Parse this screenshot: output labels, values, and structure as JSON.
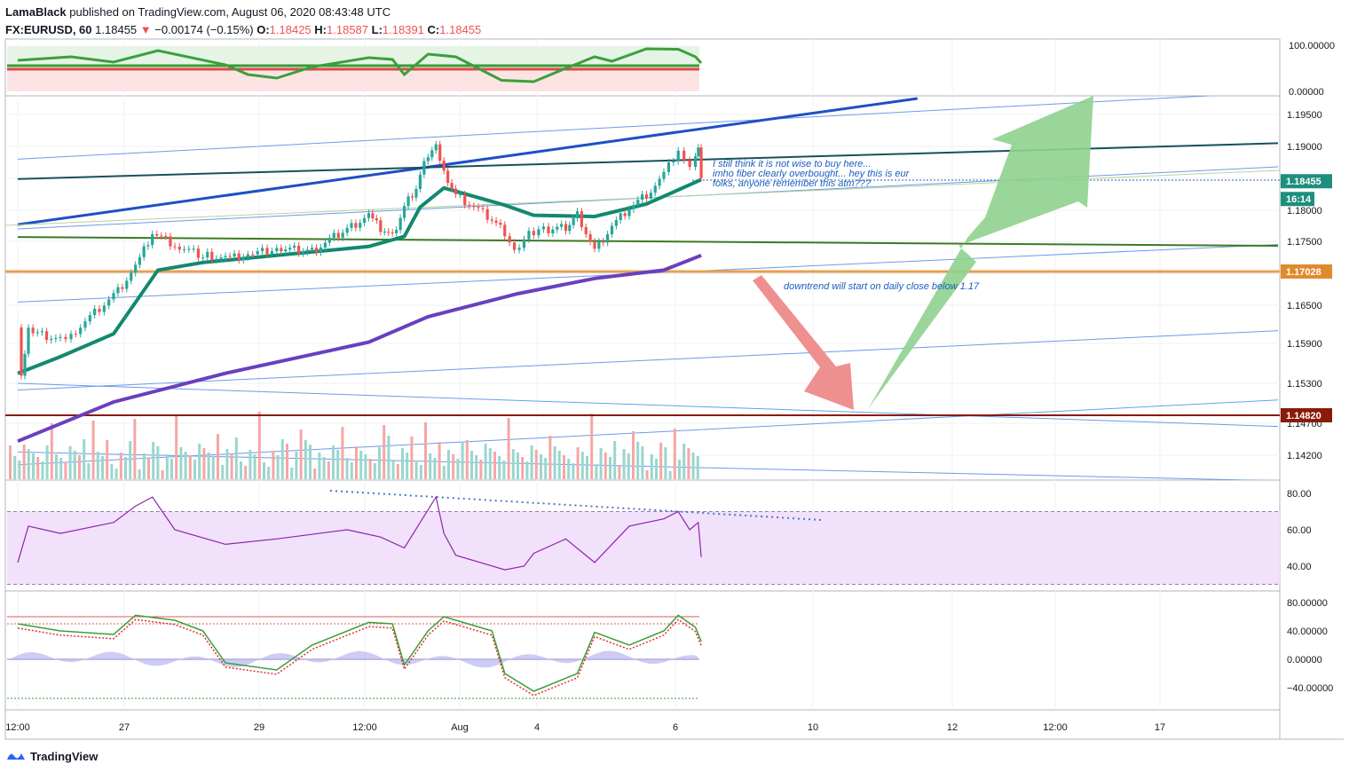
{
  "header": {
    "publisher": "LamaBlack",
    "published_text": "published on TradingView.com, August 06, 2020 08:43:48 UTC",
    "symbol": "FX:EURUSD, 60",
    "last": "1.18455",
    "change": "−0.00174 (−0.15%)",
    "o_label": "O:",
    "o": "1.18425",
    "h_label": "H:",
    "h": "1.18587",
    "l_label": "L:",
    "l": "1.18391",
    "c_label": "C:",
    "c": "1.18455"
  },
  "footer": {
    "brand": "TradingView"
  },
  "colors": {
    "price_axis_bg": "#ffffff",
    "blue_trend": "#1e4fc7",
    "dark_teal_line": "#17515a",
    "green_line": "#3a7a24",
    "orange_level": "#e8a050",
    "darkred_level": "#8a1a0a",
    "teal_ma": "#12896f",
    "purple_ma": "#6a3fbf",
    "up_candle": "#26a69a",
    "down_candle": "#ef5350",
    "rsi_line": "#8e24aa",
    "rsi_band": "#f1e1fb",
    "green_arrow": "#8fd18f",
    "red_arrow": "#ee8a8a"
  },
  "price_axis": {
    "labels": [
      "1.19500",
      "1.19000",
      "1.18000",
      "1.17500",
      "1.16500",
      "1.15900",
      "1.15300",
      "1.14700",
      "1.14200"
    ],
    "current_price": "1.18455",
    "countdown": "16:14",
    "level_orange": "1.17028",
    "level_darkred": "1.14820"
  },
  "top_osc_axis": {
    "labels": [
      "100.00000",
      "0.00000"
    ]
  },
  "rsi_axis": {
    "labels": [
      "80.00",
      "60.00",
      "40.00"
    ]
  },
  "stoch_axis": {
    "labels": [
      "80.00000",
      "40.00000",
      "0.00000",
      "−40.00000"
    ]
  },
  "time_axis": {
    "labels": [
      "12:00",
      "27",
      "29",
      "12:00",
      "Aug",
      "4",
      "6",
      "10",
      "12",
      "12:00",
      "17"
    ]
  },
  "annotations": {
    "note_lines": [
      "I still think it is not wise to buy here...",
      "imho fiber clearly overbought... hey this is eur",
      "folks, anyone remember this atm???"
    ],
    "downtrend_note": "downtrend will start on daily close below 1.17"
  },
  "chart_data": {
    "type": "candlestick",
    "symbol": "FX:EURUSD",
    "timeframe": "60",
    "x_range": [
      "Jul 24 12:00",
      "Aug 18"
    ],
    "ylim": [
      1.139,
      1.2
    ],
    "key_path": [
      [
        "Jul 24 12:00",
        1.1615
      ],
      [
        "Jul 24 14:00",
        1.1535
      ],
      [
        "Jul 24 18:00",
        1.1608
      ],
      [
        "Jul 25 12:00",
        1.1595
      ],
      [
        "Jul 25 18:00",
        1.1605
      ],
      [
        "Jul 26 18:00",
        1.1664
      ],
      [
        "Jul 27 04:00",
        1.171
      ],
      [
        "Jul 27 10:00",
        1.1765
      ],
      [
        "Jul 27 18:00",
        1.1745
      ],
      [
        "Jul 28 04:00",
        1.1728
      ],
      [
        "Jul 28 12:00",
        1.1722
      ],
      [
        "Jul 28 20:00",
        1.1728
      ],
      [
        "Jul 29 04:00",
        1.1738
      ],
      [
        "Jul 29 12:00",
        1.1735
      ],
      [
        "Jul 29 20:00",
        1.177
      ],
      [
        "Jul 30 02:00",
        1.1792
      ],
      [
        "Jul 30 08:00",
        1.1772
      ],
      [
        "Jul 30 14:00",
        1.1758
      ],
      [
        "Jul 30 20:00",
        1.1805
      ],
      [
        "Jul 31 02:00",
        1.1835
      ],
      [
        "Jul 31 08:00",
        1.1888
      ],
      [
        "Jul 31 12:00",
        1.19
      ],
      [
        "Jul 31 16:00",
        1.1862
      ],
      [
        "Jul 31 22:00",
        1.1825
      ],
      [
        "Aug 2 20:00",
        1.1785
      ],
      [
        "Aug 3 04:00",
        1.1765
      ],
      [
        "Aug 3 10:00",
        1.1735
      ],
      [
        "Aug 3 16:00",
        1.1755
      ],
      [
        "Aug 3 22:00",
        1.1765
      ],
      [
        "Aug 4 04:00",
        1.1768
      ],
      [
        "Aug 4 10:00",
        1.1772
      ],
      [
        "Aug 4 14:00",
        1.1795
      ],
      [
        "Aug 4 20:00",
        1.1735
      ],
      [
        "Aug 5 02:00",
        1.1775
      ],
      [
        "Aug 5 08:00",
        1.1805
      ],
      [
        "Aug 5 14:00",
        1.1825
      ],
      [
        "Aug 5 20:00",
        1.1855
      ],
      [
        "Aug 6 02:00",
        1.1895
      ],
      [
        "Aug 6 06:00",
        1.1875
      ],
      [
        "Aug 6 10:00",
        1.1868
      ],
      [
        "Aug 6 14:00",
        1.1888
      ],
      [
        "Aug 6 16:00",
        1.1905
      ],
      [
        "Aug 6 18:00",
        1.18455
      ]
    ],
    "indicators": {
      "teal_ma_path": [
        [
          "Jul 24 12:00",
          1.1545
        ],
        [
          "Jul 25 12:00",
          1.157
        ],
        [
          "Jul 26 18:00",
          1.1605
        ],
        [
          "Jul 27 12:00",
          1.1705
        ],
        [
          "Jul 28 04:00",
          1.1717
        ],
        [
          "Jul 29 04:00",
          1.1728
        ],
        [
          "Jul 30 02:00",
          1.1742
        ],
        [
          "Jul 30 20:00",
          1.1758
        ],
        [
          "Jul 31 04:00",
          1.1805
        ],
        [
          "Jul 31 16:00",
          1.1835
        ],
        [
          "Aug 3 04:00",
          1.1808
        ],
        [
          "Aug 3 22:00",
          1.1792
        ],
        [
          "Aug 4 20:00",
          1.179
        ],
        [
          "Aug 5 14:00",
          1.181
        ],
        [
          "Aug 6 02:00",
          1.1832
        ],
        [
          "Aug 6 18:00",
          1.1848
        ]
      ],
      "purple_ma_path": [
        [
          "Jul 24 12:00",
          1.1442
        ],
        [
          "Jul 26 18:00",
          1.1502
        ],
        [
          "Jul 28 12:00",
          1.1545
        ],
        [
          "Jul 30 02:00",
          1.1592
        ],
        [
          "Jul 31 08:00",
          1.1632
        ],
        [
          "Aug 3 12:00",
          1.1668
        ],
        [
          "Aug 4 20:00",
          1.1692
        ],
        [
          "Aug 5 20:00",
          1.1705
        ],
        [
          "Aug 6 18:00",
          1.1728
        ]
      ]
    },
    "horizontal_levels": [
      {
        "price": 1.17028,
        "color": "#e8a050"
      },
      {
        "price": 1.1482,
        "color": "#8a1a0a"
      }
    ],
    "trendlines": [
      {
        "from": [
          "Jul 24 12:00",
          1.1777
        ],
        "to": [
          "Aug 11 12:00",
          1.1975
        ],
        "color": "#1e4fc7"
      },
      {
        "from": [
          "Jul 24 12:00",
          1.1849
        ],
        "to": [
          "Aug 18",
          1.1905
        ],
        "color": "#17515a"
      },
      {
        "from": [
          "Jul 24 12:00",
          1.1757
        ],
        "to": [
          "Aug 18",
          1.1743
        ],
        "color": "#3a7a24"
      }
    ],
    "top_oscillator": {
      "axis": [
        0,
        100
      ],
      "path": [
        [
          "Jul 24 12:00",
          70
        ],
        [
          "Jul 25 18:00",
          78
        ],
        [
          "Jul 26 18:00",
          66
        ],
        [
          "Jul 27 12:00",
          92
        ],
        [
          "Jul 28 12:00",
          60
        ],
        [
          "Jul 28 20:00",
          38
        ],
        [
          "Jul 29 04:00",
          30
        ],
        [
          "Jul 29 12:00",
          55
        ],
        [
          "Jul 30 02:00",
          76
        ],
        [
          "Jul 30 14:00",
          72
        ],
        [
          "Jul 30 20:00",
          38
        ],
        [
          "Jul 31 08:00",
          84
        ],
        [
          "Jul 31 22:00",
          78
        ],
        [
          "Aug 3 02:00",
          25
        ],
        [
          "Aug 3 22:00",
          22
        ],
        [
          "Aug 4 10:00",
          52
        ],
        [
          "Aug 4 20:00",
          78
        ],
        [
          "Aug 5 02:00",
          68
        ],
        [
          "Aug 5 14:00",
          96
        ],
        [
          "Aug 6 02:00",
          95
        ],
        [
          "Aug 6 14:00",
          78
        ],
        [
          "Aug 6 18:00",
          64
        ]
      ]
    },
    "rsi": {
      "axis_labels": [
        80,
        60,
        40
      ],
      "band": [
        30,
        70
      ],
      "path": [
        [
          "Jul 24 12:00",
          42
        ],
        [
          "Jul 24 18:00",
          62
        ],
        [
          "Jul 25 12:00",
          58
        ],
        [
          "Jul 26 18:00",
          64
        ],
        [
          "Jul 27 04:00",
          73
        ],
        [
          "Jul 27 10:00",
          78
        ],
        [
          "Jul 27 18:00",
          60
        ],
        [
          "Jul 28 12:00",
          52
        ],
        [
          "Jul 29 04:00",
          55
        ],
        [
          "Jul 29 20:00",
          60
        ],
        [
          "Jul 30 08:00",
          56
        ],
        [
          "Jul 30 20:00",
          50
        ],
        [
          "Jul 31 04:00",
          64
        ],
        [
          "Jul 31 12:00",
          78
        ],
        [
          "Jul 31 16:00",
          58
        ],
        [
          "Jul 31 22:00",
          46
        ],
        [
          "Aug 3 04:00",
          38
        ],
        [
          "Aug 3 16:00",
          40
        ],
        [
          "Aug 3 22:00",
          47
        ],
        [
          "Aug 4 10:00",
          55
        ],
        [
          "Aug 4 20:00",
          42
        ],
        [
          "Aug 5 08:00",
          62
        ],
        [
          "Aug 5 20:00",
          66
        ],
        [
          "Aug 6 02:00",
          70
        ],
        [
          "Aug 6 10:00",
          60
        ],
        [
          "Aug 6 16:00",
          64
        ],
        [
          "Aug 6 18:00",
          45
        ]
      ]
    },
    "stochastic": {
      "axis_labels": [
        80,
        40,
        0,
        -40
      ],
      "k_path": [
        [
          "Jul 24 12:00",
          50
        ],
        [
          "Jul 25 12:00",
          40
        ],
        [
          "Jul 26 18:00",
          35
        ],
        [
          "Jul 27 04:00",
          62
        ],
        [
          "Jul 27 18:00",
          55
        ],
        [
          "Jul 28 04:00",
          40
        ],
        [
          "Jul 28 12:00",
          -5
        ],
        [
          "Jul 29 04:00",
          -15
        ],
        [
          "Jul 29 12:00",
          20
        ],
        [
          "Jul 30 02:00",
          52
        ],
        [
          "Jul 30 14:00",
          50
        ],
        [
          "Jul 30 20:00",
          -8
        ],
        [
          "Jul 31 08:00",
          40
        ],
        [
          "Jul 31 16:00",
          60
        ],
        [
          "Aug 2 20:00",
          40
        ],
        [
          "Aug 3 04:00",
          -20
        ],
        [
          "Aug 3 22:00",
          -45
        ],
        [
          "Aug 4 14:00",
          -20
        ],
        [
          "Aug 4 20:00",
          38
        ],
        [
          "Aug 5 08:00",
          20
        ],
        [
          "Aug 5 20:00",
          40
        ],
        [
          "Aug 6 02:00",
          62
        ],
        [
          "Aug 6 14:00",
          45
        ],
        [
          "Aug 6 18:00",
          25
        ]
      ]
    }
  }
}
